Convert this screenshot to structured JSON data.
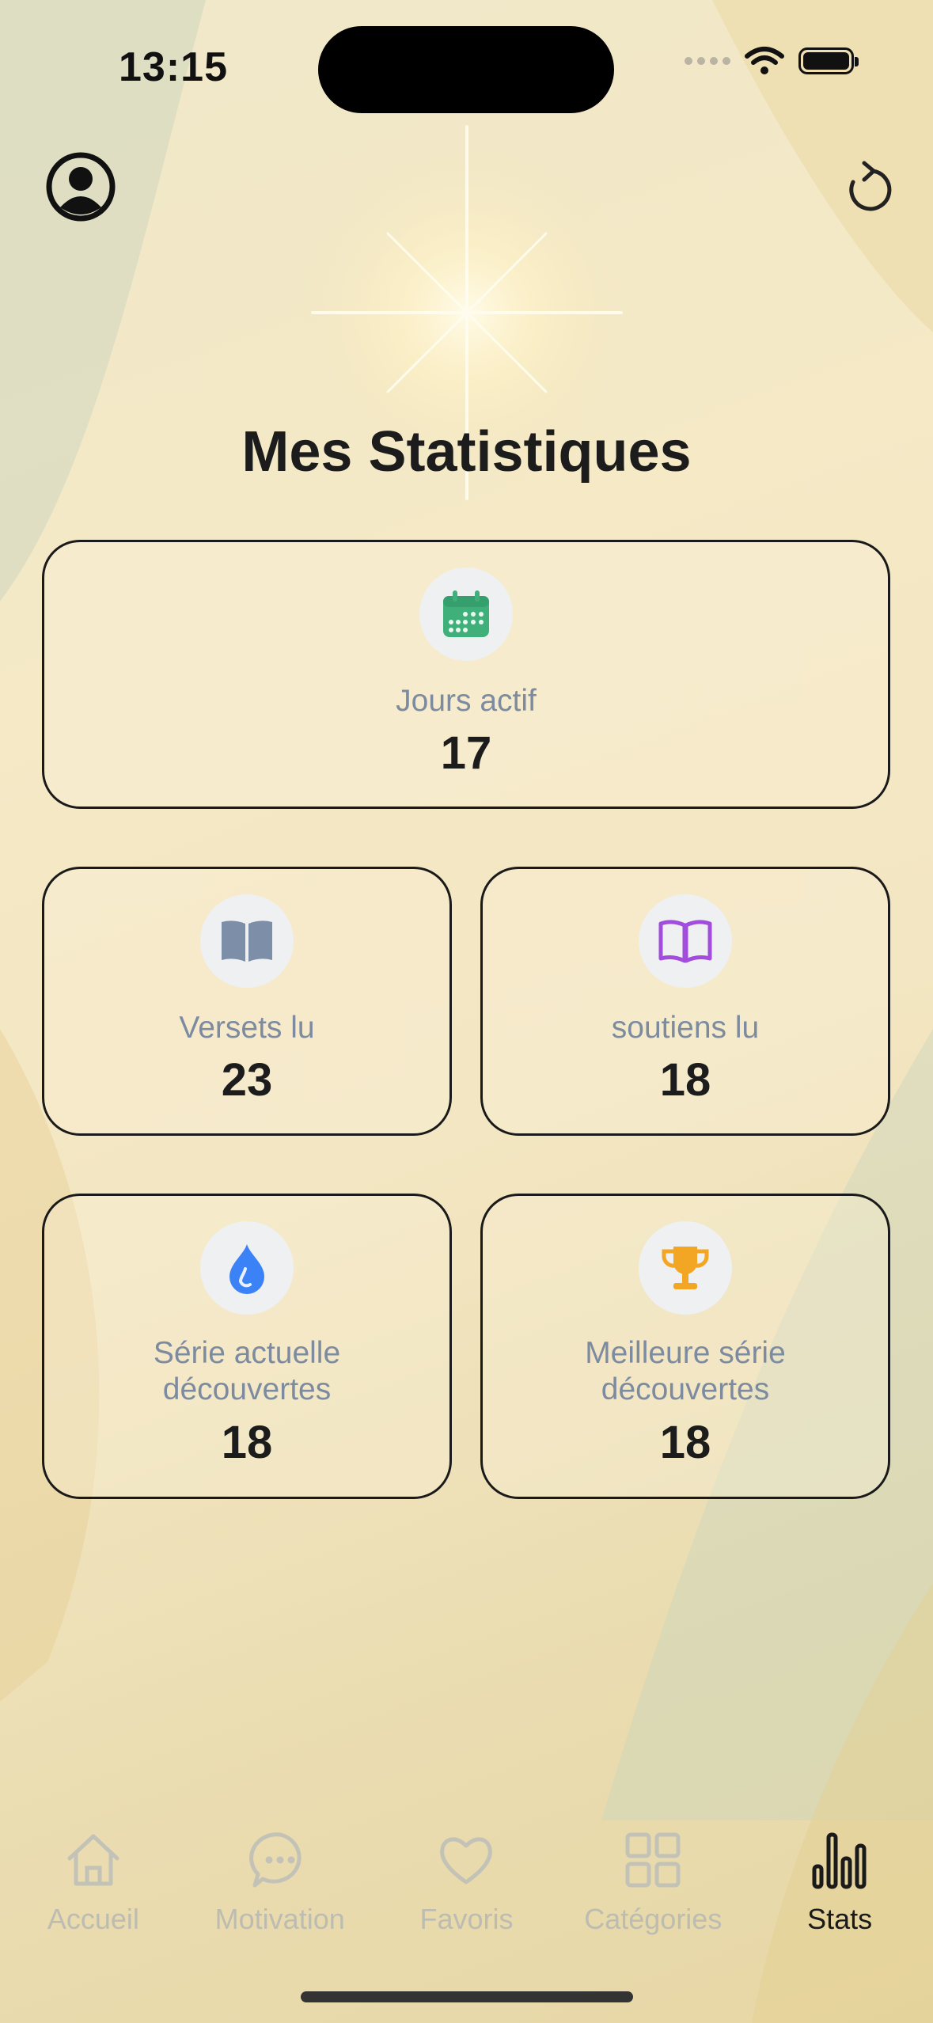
{
  "status_bar": {
    "time": "13:15"
  },
  "header": {
    "title": "Mes Statistiques"
  },
  "stats": {
    "active_days": {
      "label": "Jours actif",
      "value": "17",
      "icon": "calendar-icon",
      "color": "#3fb07a"
    },
    "verses_read": {
      "label": "Versets lu",
      "value": "23",
      "icon": "book-icon",
      "color": "#7c8ea8"
    },
    "supports_read": {
      "label": "soutiens lu",
      "value": "18",
      "icon": "open-book-icon",
      "color": "#a24ddc"
    },
    "current_streak": {
      "label_line1": "Série actuelle",
      "label_line2": "découvertes",
      "value": "18",
      "icon": "flame-icon",
      "color": "#3b82f6"
    },
    "best_streak": {
      "label_line1": "Meilleure série",
      "label_line2": "découvertes",
      "value": "18",
      "icon": "trophy-icon",
      "color": "#f2a623"
    }
  },
  "tabs": [
    {
      "label": "Accueil",
      "icon": "home-icon",
      "active": false
    },
    {
      "label": "Motivation",
      "icon": "chat-bubble-icon",
      "active": false
    },
    {
      "label": "Favoris",
      "icon": "heart-icon",
      "active": false
    },
    {
      "label": "Catégories",
      "icon": "grid-icon",
      "active": false
    },
    {
      "label": "Stats",
      "icon": "bar-chart-icon",
      "active": true
    }
  ]
}
